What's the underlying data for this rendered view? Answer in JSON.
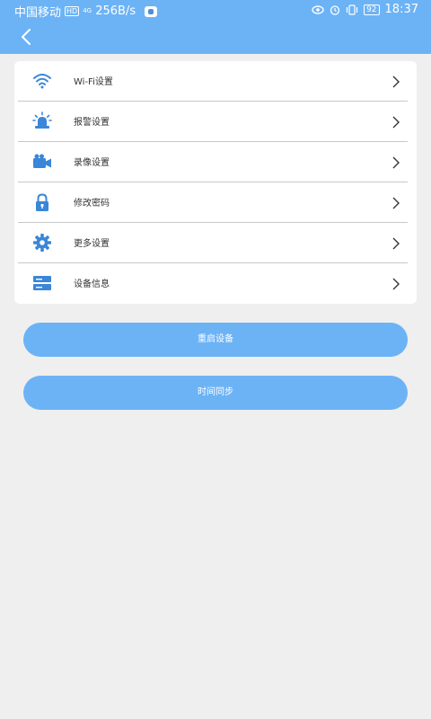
{
  "status_bar": {
    "carrier": "中国移动",
    "hd_badge": "HD",
    "signal_label": "4G",
    "speed": "256B/s",
    "battery": "92",
    "time": "18:37"
  },
  "menu": [
    {
      "label": "Wi-Fi设置"
    },
    {
      "label": "报警设置"
    },
    {
      "label": "录像设置"
    },
    {
      "label": "修改密码"
    },
    {
      "label": "更多设置"
    },
    {
      "label": "设备信息"
    }
  ],
  "buttons": {
    "reboot_label": "重启设备",
    "sync_label": "时间同步"
  },
  "colors": {
    "accent": "#6cb3f6",
    "icon": "#3a86d8",
    "background": "#efefef"
  }
}
